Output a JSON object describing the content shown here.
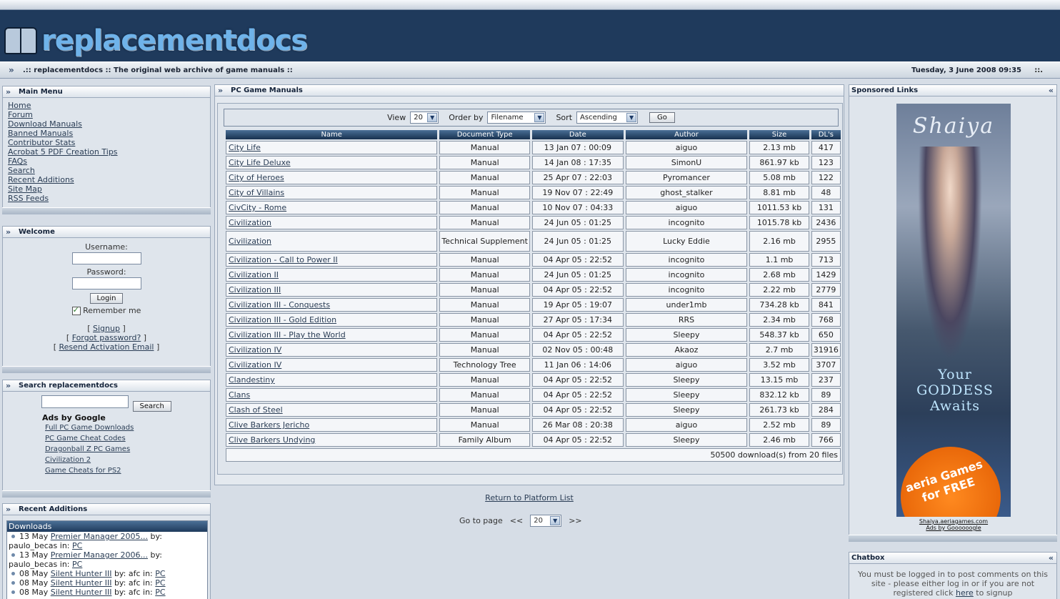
{
  "header": {
    "logo_text": "replacementdocs",
    "tagline": ".:: replacementdocs :: The original web archive of game manuals ::",
    "datetime": "Tuesday, 3 June 2008 09:35",
    "dots": "::."
  },
  "main_menu": {
    "title": "Main Menu",
    "items": [
      "Home",
      "Forum",
      "Download Manuals",
      "Banned Manuals",
      "Contributor Stats",
      "Acrobat 5 PDF Creation Tips",
      "FAQs",
      "Search",
      "Recent Additions",
      "Site Map",
      "RSS Feeds"
    ]
  },
  "welcome": {
    "title": "Welcome",
    "username_label": "Username:",
    "password_label": "Password:",
    "login_button": "Login",
    "remember_label": "Remember me",
    "signup": "Signup",
    "forgot": "Forgot password?",
    "resend": "Resend Activation Email",
    "lb": "[",
    "rb": "]"
  },
  "search_box": {
    "title": "Search replacementdocs",
    "button": "Search",
    "ads_title": "Ads by Google",
    "ads": [
      "Full PC Game Downloads",
      "PC Game Cheat Codes",
      "Dragonball Z PC Games",
      "Civilization 2",
      "Game Cheats for PS2"
    ]
  },
  "recent": {
    "title": "Recent Additions",
    "section": "Downloads",
    "items": [
      {
        "date": "13 May",
        "title": "Premier Manager 2005...",
        "by": "by:",
        "user": "paulo_becas",
        "in": "in:",
        "platform": "PC"
      },
      {
        "date": "13 May",
        "title": "Premier Manager 2006...",
        "by": "by:",
        "user": "paulo_becas",
        "in": "in:",
        "platform": "PC"
      },
      {
        "date": "08 May",
        "title": "Silent Hunter III",
        "by": "by:",
        "user": "afc",
        "in": "in:",
        "platform": "PC"
      },
      {
        "date": "08 May",
        "title": "Silent Hunter III",
        "by": "by:",
        "user": "afc",
        "in": "in:",
        "platform": "PC"
      },
      {
        "date": "08 May",
        "title": "Silent Hunter III",
        "by": "by:",
        "user": "afc",
        "in": "in:",
        "platform": "PC"
      }
    ]
  },
  "manuals": {
    "title": "PC Game Manuals",
    "view_label": "View",
    "view_value": "20",
    "order_label": "Order by",
    "order_value": "Filename",
    "sort_label": "Sort",
    "sort_value": "Ascending",
    "go_button": "Go",
    "columns": [
      "Name",
      "Document Type",
      "Date",
      "Author",
      "Size",
      "DL's"
    ],
    "rows": [
      [
        "City Life",
        "Manual",
        "13 Jan 07 : 00:09",
        "aiguo",
        "2.13 mb",
        "417"
      ],
      [
        "City Life Deluxe",
        "Manual",
        "14 Jan 08 : 17:35",
        "SimonU",
        "861.97 kb",
        "123"
      ],
      [
        "City of Heroes",
        "Manual",
        "25 Apr 07 : 22:03",
        "Pyromancer",
        "5.08 mb",
        "122"
      ],
      [
        "City of Villains",
        "Manual",
        "19 Nov 07 : 22:49",
        "ghost_stalker",
        "8.81 mb",
        "48"
      ],
      [
        "CivCity - Rome",
        "Manual",
        "10 Nov 07 : 04:33",
        "aiguo",
        "1011.53 kb",
        "131"
      ],
      [
        "Civilization",
        "Manual",
        "24 Jun 05 : 01:25",
        "incognito",
        "1015.78 kb",
        "2436"
      ],
      [
        "Civilization",
        "Technical Supplement",
        "24 Jun 05 : 01:25",
        "Lucky Eddie",
        "2.16 mb",
        "2955"
      ],
      [
        "Civilization - Call to Power II",
        "Manual",
        "04 Apr 05 : 22:52",
        "incognito",
        "1.1 mb",
        "713"
      ],
      [
        "Civilization II",
        "Manual",
        "24 Jun 05 : 01:25",
        "incognito",
        "2.68 mb",
        "1429"
      ],
      [
        "Civilization III",
        "Manual",
        "04 Apr 05 : 22:52",
        "incognito",
        "2.22 mb",
        "2779"
      ],
      [
        "Civilization III - Conquests",
        "Manual",
        "19 Apr 05 : 19:07",
        "under1mb",
        "734.28 kb",
        "841"
      ],
      [
        "Civilization III - Gold Edition",
        "Manual",
        "27 Apr 05 : 17:34",
        "RRS",
        "2.34 mb",
        "768"
      ],
      [
        "Civilization III - Play the World",
        "Manual",
        "04 Apr 05 : 22:52",
        "Sleepy",
        "548.37 kb",
        "650"
      ],
      [
        "Civilization IV",
        "Manual",
        "02 Nov 05 : 00:48",
        "Akaoz",
        "2.7 mb",
        "31916"
      ],
      [
        "Civilization IV",
        "Technology Tree",
        "11 Jan 06 : 14:06",
        "aiguo",
        "3.52 mb",
        "3707"
      ],
      [
        "Clandestiny",
        "Manual",
        "04 Apr 05 : 22:52",
        "Sleepy",
        "13.15 mb",
        "237"
      ],
      [
        "Clans",
        "Manual",
        "04 Apr 05 : 22:52",
        "Sleepy",
        "832.12 kb",
        "89"
      ],
      [
        "Clash of Steel",
        "Manual",
        "04 Apr 05 : 22:52",
        "Sleepy",
        "261.73 kb",
        "284"
      ],
      [
        "Clive Barkers Jericho",
        "Manual",
        "26 Mar 08 : 20:38",
        "aiguo",
        "2.52 mb",
        "89"
      ],
      [
        "Clive Barkers Undying",
        "Family Album",
        "04 Apr 05 : 22:52",
        "Sleepy",
        "2.46 mb",
        "766"
      ]
    ],
    "footer": "50500 download(s) from 20 files",
    "return_link": "Return to Platform List",
    "goto_label": "Go to page",
    "prev": "<<",
    "page_value": "20",
    "next": ">>"
  },
  "sponsored": {
    "title": "Sponsored Links",
    "ad_title": "Shaiya",
    "ad_tagline": "Your GODDESS Awaits",
    "ad_badge": "aeria Games for FREE",
    "ad_url": "Shaiya.aeriagames.com",
    "ads_by": "Ads by Goooooogle"
  },
  "chatbox": {
    "title": "Chatbox",
    "message_pre": "You must be logged in to post comments on this site - please either log in or if you are not registered click",
    "here": "here",
    "message_post": "to signup"
  }
}
